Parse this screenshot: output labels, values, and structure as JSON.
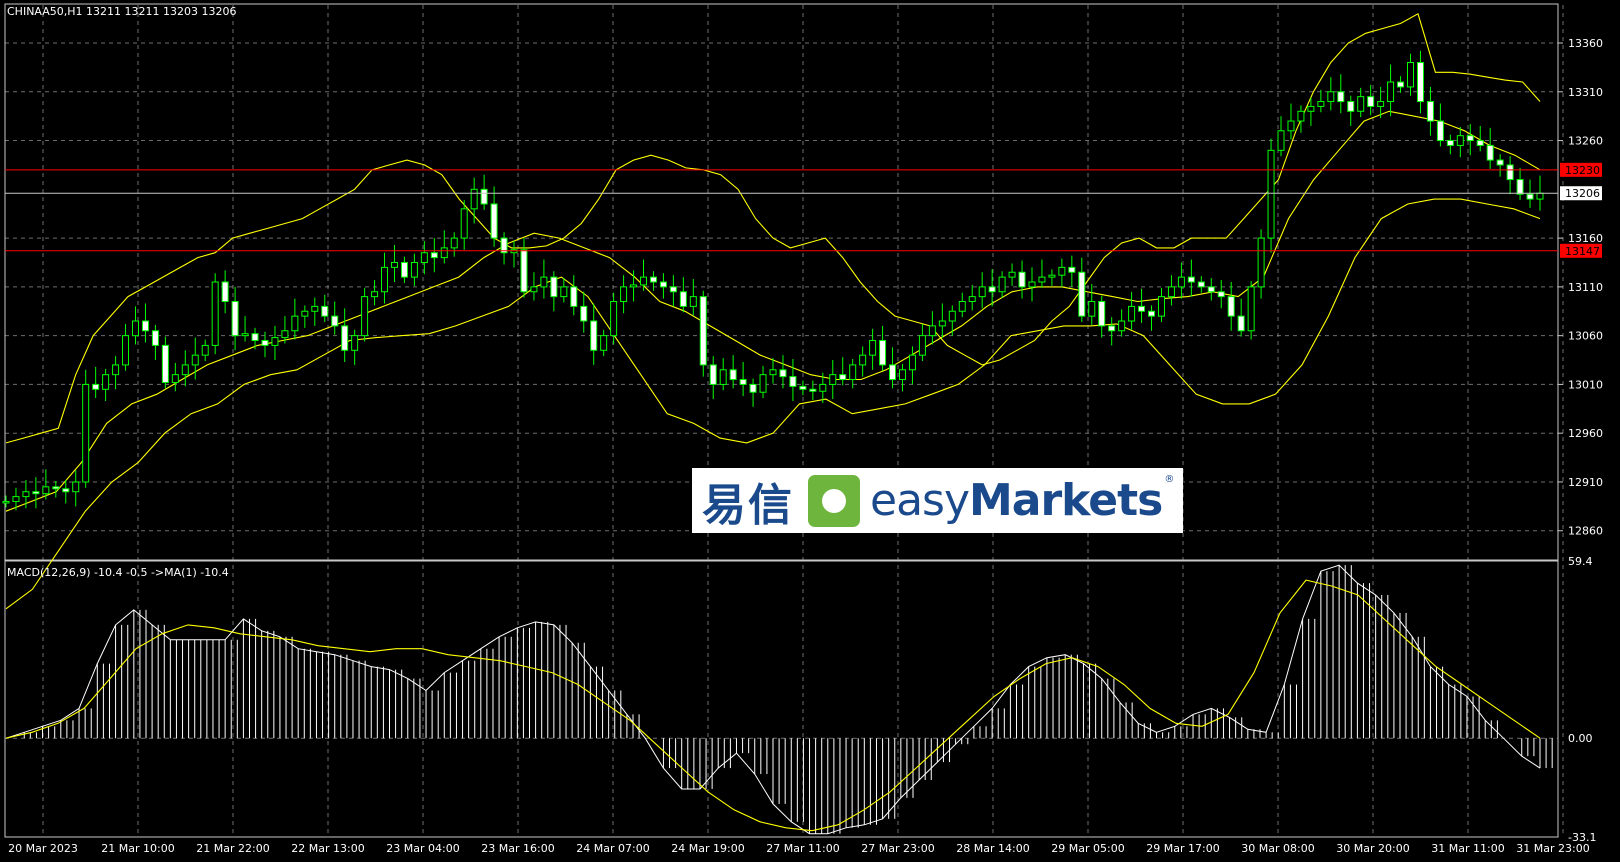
{
  "header": {
    "symbol": "CHINAA50,H1",
    "ohlc": "13211 13211 13203 13206"
  },
  "indicator_header": "MACD(12,26,9) -10.4 -0.5  ->MA(1) -10.4",
  "logo": {
    "cn": "易信",
    "en_thin": "easy",
    "en_bold": "Markets",
    "reg": "®"
  },
  "colors": {
    "background": "#000000",
    "grid": "#c8c8c8",
    "candle_up": "#000000",
    "candle_outline": "#00ff00",
    "candle_down": "#ffffff",
    "bands": "#ffff00",
    "level_line": "#ff0000",
    "macd_hist": "#ffffff",
    "macd_signal": "#ffff00"
  },
  "chart_data": [
    {
      "type": "line",
      "title": "CHINAA50,H1",
      "ylim": [
        12830,
        13400
      ],
      "y_ticks": [
        "13360",
        "13310",
        "13260",
        "13160",
        "13110",
        "13060",
        "13010",
        "12960",
        "12910",
        "12860"
      ],
      "x_ticks": [
        "20 Mar 2023",
        "21 Mar 10:00",
        "21 Mar 22:00",
        "22 Mar 13:00",
        "23 Mar 04:00",
        "23 Mar 16:00",
        "24 Mar 07:00",
        "24 Mar 19:00",
        "27 Mar 11:00",
        "27 Mar 23:00",
        "28 Mar 14:00",
        "29 Mar 05:00",
        "29 Mar 17:00",
        "30 Mar 08:00",
        "30 Mar 20:00",
        "31 Mar 11:00",
        "31 Mar 23:00"
      ],
      "levels": [
        {
          "value": 13230,
          "label": "13230",
          "color": "#ff0000"
        },
        {
          "value": 13147,
          "label": "13147",
          "color": "#ff0000"
        }
      ],
      "current_price": {
        "value": 13206,
        "label": "13206"
      },
      "series": [
        {
          "name": "close",
          "values": [
            12890,
            12895,
            12900,
            12898,
            12905,
            12903,
            12900,
            12910,
            13010,
            13005,
            13020,
            13030,
            13060,
            13075,
            13065,
            13050,
            13012,
            13020,
            13030,
            13040,
            13050,
            13115,
            13095,
            13060,
            13062,
            13055,
            13050,
            13058,
            13065,
            13080,
            13085,
            13090,
            13080,
            13070,
            13045,
            13060,
            13100,
            13105,
            13130,
            13135,
            13120,
            13135,
            13145,
            13140,
            13150,
            13160,
            13190,
            13210,
            13195,
            13160,
            13145,
            13148,
            13105,
            13110,
            13120,
            13100,
            13110,
            13090,
            13075,
            13045,
            13060,
            13095,
            13110,
            13112,
            13120,
            13115,
            13110,
            13105,
            13090,
            13100,
            13030,
            13010,
            13025,
            13015,
            13010,
            13002,
            13020,
            13025,
            13018,
            13008,
            13005,
            13003,
            13010,
            13020,
            13015,
            13030,
            13040,
            13055,
            13030,
            13015,
            13025,
            13040,
            13060,
            13070,
            13075,
            13085,
            13095,
            13100,
            13110,
            13105,
            13120,
            13125,
            13110,
            13115,
            13120,
            13122,
            13130,
            13125,
            13080,
            13095,
            13070,
            13065,
            13075,
            13090,
            13085,
            13080,
            13100,
            13110,
            13120,
            13115,
            13110,
            13105,
            13100,
            13080,
            13065,
            13110,
            13160,
            13250,
            13270,
            13280,
            13290,
            13295,
            13300,
            13310,
            13300,
            13290,
            13305,
            13295,
            13300,
            13320,
            13315,
            13340,
            13300,
            13280,
            13260,
            13255,
            13265,
            13260,
            13255,
            13240,
            13235,
            13220,
            13205,
            13200,
            13206
          ]
        },
        {
          "name": "upper",
          "values": [
            12950,
            12955,
            12960,
            12965,
            13020,
            13060,
            13080,
            13100,
            13110,
            13120,
            13130,
            13140,
            13145,
            13160,
            13165,
            13170,
            13175,
            13180,
            13190,
            13200,
            13210,
            13230,
            13235,
            13240,
            13235,
            13225,
            13200,
            13180,
            13160,
            13150,
            13150,
            13152,
            13160,
            13175,
            13200,
            13230,
            13240,
            13245,
            13240,
            13232,
            13230,
            13225,
            13210,
            13180,
            13160,
            13150,
            13155,
            13160,
            13140,
            13115,
            13095,
            13080,
            13075,
            13070,
            13050,
            13040,
            13030,
            13035,
            13045,
            13055,
            13075,
            13090,
            13115,
            13140,
            13155,
            13160,
            13150,
            13150,
            13160,
            13160,
            13160,
            13180,
            13200,
            13220,
            13270,
            13310,
            13340,
            13360,
            13370,
            13375,
            13380,
            13390,
            13330,
            13330,
            13328,
            13325,
            13322,
            13320,
            13300
          ]
        },
        {
          "name": "middle",
          "values": [
            12880,
            12890,
            12900,
            12930,
            12970,
            12990,
            13000,
            13015,
            13030,
            13040,
            13050,
            13055,
            13060,
            13070,
            13080,
            13090,
            13100,
            13110,
            13120,
            13140,
            13155,
            13165,
            13160,
            13150,
            13140,
            13120,
            13095,
            13085,
            13070,
            13055,
            13040,
            13030,
            13020,
            13015,
            13015,
            13025,
            13040,
            13055,
            13070,
            13090,
            13105,
            13110,
            13110,
            13105,
            13100,
            13095,
            13098,
            13100,
            13105,
            13100,
            13120,
            13180,
            13220,
            13250,
            13280,
            13290,
            13285,
            13280,
            13270,
            13255,
            13245,
            13230
          ]
        },
        {
          "name": "lower",
          "values": [
            12780,
            12800,
            12840,
            12880,
            12910,
            12930,
            12960,
            12980,
            12990,
            13010,
            13020,
            13025,
            13040,
            13055,
            13058,
            13060,
            13062,
            13070,
            13080,
            13090,
            13110,
            13120,
            13100,
            13060,
            13020,
            12980,
            12970,
            12955,
            12950,
            12960,
            12990,
            12995,
            12980,
            12985,
            12990,
            13000,
            13010,
            13030,
            13060,
            13065,
            13070,
            13070,
            13072,
            13060,
            13030,
            13000,
            12990,
            12990,
            13000,
            13030,
            13080,
            13140,
            13180,
            13195,
            13200,
            13200,
            13195,
            13190,
            13180
          ]
        }
      ]
    },
    {
      "type": "bar",
      "title": "MACD(12,26,9)",
      "ylim": [
        -33.1,
        59.4
      ],
      "y_ticks": [
        "59.4",
        "0.00",
        "-33.1"
      ],
      "series": [
        {
          "name": "MACD",
          "values": [
            0,
            2,
            4,
            6,
            10,
            25,
            38,
            43,
            38,
            33,
            33,
            33,
            33,
            40,
            36,
            34,
            30,
            29,
            28,
            26,
            24,
            23,
            20,
            16,
            22,
            26,
            30,
            34,
            37,
            39,
            38,
            32,
            24,
            16,
            8,
            0,
            -10,
            -17,
            -17,
            -10,
            -5,
            -12,
            -22,
            -28,
            -32,
            -32,
            -30,
            -29,
            -27,
            -20,
            -14,
            -8,
            -2,
            4,
            10,
            18,
            24,
            27,
            28,
            25,
            20,
            12,
            5,
            2,
            4,
            8,
            10,
            7,
            3,
            2,
            18,
            40,
            56,
            58,
            52,
            48,
            42,
            34,
            24,
            18,
            14,
            6,
            0,
            -6,
            -10
          ]
        },
        {
          "name": "Signal",
          "values": [
            0,
            2,
            5,
            10,
            20,
            30,
            35,
            38,
            37,
            35,
            34,
            33,
            31,
            30,
            29,
            30,
            30,
            28,
            27,
            26,
            24,
            22,
            18,
            12,
            6,
            -2,
            -10,
            -18,
            -24,
            -28,
            -30,
            -31,
            -29,
            -24,
            -18,
            -10,
            -2,
            6,
            14,
            20,
            25,
            27,
            24,
            18,
            10,
            5,
            4,
            8,
            22,
            42,
            53,
            51,
            48,
            40,
            32,
            24,
            18,
            12,
            6,
            0
          ]
        }
      ]
    }
  ]
}
